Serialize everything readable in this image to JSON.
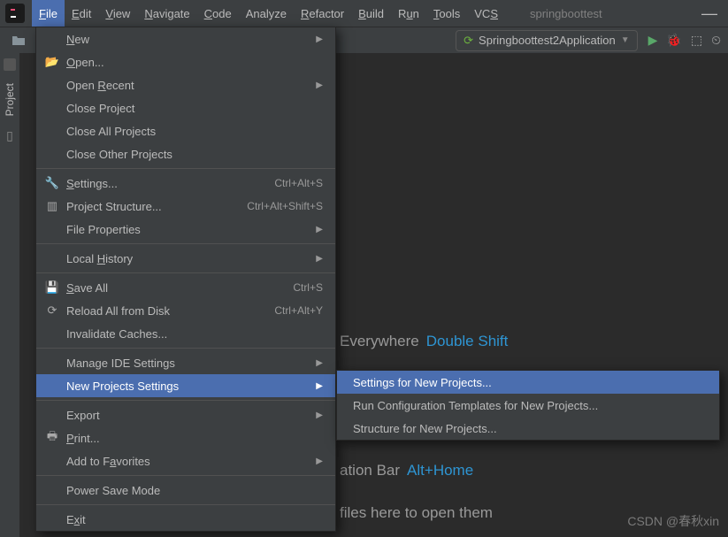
{
  "menubar": {
    "items": [
      "File",
      "Edit",
      "View",
      "Navigate",
      "Code",
      "Analyze",
      "Refactor",
      "Build",
      "Run",
      "Tools",
      "VCS"
    ],
    "title": "springboottest"
  },
  "toolbar": {
    "run_config": "Springboottest2Application"
  },
  "gutter": {
    "project": "Project"
  },
  "file_menu": {
    "new": "New",
    "open": "Open...",
    "open_recent": "Open Recent",
    "close_project": "Close Project",
    "close_all": "Close All Projects",
    "close_other": "Close Other Projects",
    "settings": "Settings...",
    "settings_sc": "Ctrl+Alt+S",
    "project_structure": "Project Structure...",
    "project_structure_sc": "Ctrl+Alt+Shift+S",
    "file_properties": "File Properties",
    "local_history": "Local History",
    "save_all": "Save All",
    "save_all_sc": "Ctrl+S",
    "reload": "Reload All from Disk",
    "reload_sc": "Ctrl+Alt+Y",
    "invalidate": "Invalidate Caches...",
    "manage_ide": "Manage IDE Settings",
    "new_projects_settings": "New Projects Settings",
    "export": "Export",
    "print": "Print...",
    "favorites": "Add to Favorites",
    "power_save": "Power Save Mode",
    "exit": "Exit"
  },
  "submenu": {
    "settings_new": "Settings for New Projects...",
    "run_templates": "Run Configuration Templates for New Projects...",
    "structure_new": "Structure for New Projects..."
  },
  "editor": {
    "search_everywhere_prefix": "Everywhere",
    "search_everywhere_key": "Double Shift",
    "nav_bar_prefix": "ation Bar",
    "nav_bar_key": "Alt+Home",
    "drop_files": "files here to open them"
  },
  "watermark": "CSDN @春秋xin"
}
